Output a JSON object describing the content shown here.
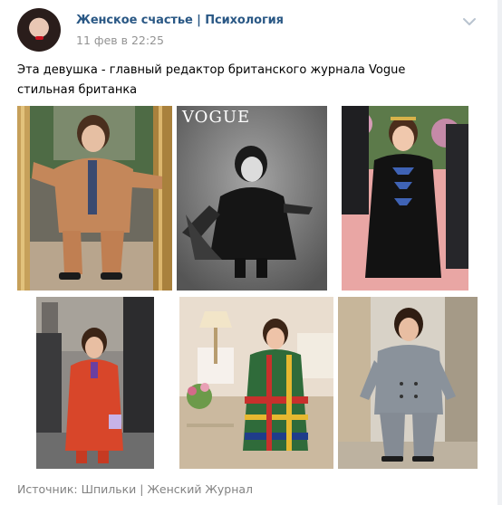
{
  "post": {
    "author": "Женское счастье | Психология",
    "date": "11 фев в 22:25",
    "text_lines": [
      "Эта девушка - главный редактор британского журнала Vogue",
      "стильная британка"
    ],
    "photos": [
      {
        "alt": "photo 1"
      },
      {
        "alt": "photo 2",
        "magazine_title": "VOGUE"
      },
      {
        "alt": "photo 3"
      },
      {
        "alt": "photo 4"
      },
      {
        "alt": "photo 5"
      },
      {
        "alt": "photo 6"
      }
    ],
    "source": {
      "prefix": "Источник:",
      "link": "Шпильки | Женский Журнал"
    }
  },
  "icons": {
    "avatar": "avatar-image",
    "menu": "chevron-down-icon"
  },
  "colors": {
    "link_blue": "#2a5885",
    "meta_gray": "#939393",
    "source_gray": "#828282"
  }
}
